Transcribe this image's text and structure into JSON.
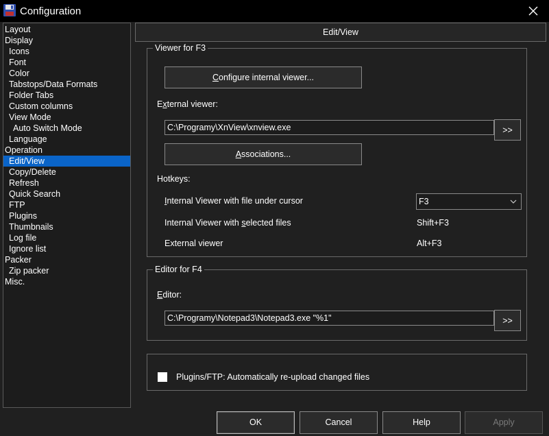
{
  "window": {
    "title": "Configuration"
  },
  "tree": {
    "items": [
      {
        "label": "Layout",
        "indent": 0
      },
      {
        "label": "Display",
        "indent": 0
      },
      {
        "label": "Icons",
        "indent": 1
      },
      {
        "label": "Font",
        "indent": 1
      },
      {
        "label": "Color",
        "indent": 1
      },
      {
        "label": "Tabstops/Data Formats",
        "indent": 1
      },
      {
        "label": "Folder Tabs",
        "indent": 1
      },
      {
        "label": "Custom columns",
        "indent": 1
      },
      {
        "label": "View Mode",
        "indent": 1
      },
      {
        "label": "Auto Switch Mode",
        "indent": 2
      },
      {
        "label": "Language",
        "indent": 1
      },
      {
        "label": "Operation",
        "indent": 0
      },
      {
        "label": "Edit/View",
        "indent": 1,
        "selected": true
      },
      {
        "label": "Copy/Delete",
        "indent": 1
      },
      {
        "label": "Refresh",
        "indent": 1
      },
      {
        "label": "Quick Search",
        "indent": 1
      },
      {
        "label": "FTP",
        "indent": 1
      },
      {
        "label": "Plugins",
        "indent": 1
      },
      {
        "label": "Thumbnails",
        "indent": 1
      },
      {
        "label": "Log file",
        "indent": 1
      },
      {
        "label": "Ignore list",
        "indent": 1
      },
      {
        "label": "Packer",
        "indent": 0
      },
      {
        "label": "Zip packer",
        "indent": 1
      },
      {
        "label": "Misc.",
        "indent": 0
      }
    ]
  },
  "pane": {
    "header": "Edit/View"
  },
  "viewer": {
    "group_title": "Viewer for F3",
    "configure_prefix": "",
    "configure_underlined": "C",
    "configure_rest": "onfigure internal viewer...",
    "external_label_prefix": "E",
    "external_label_underlined": "x",
    "external_label_rest": "ternal viewer:",
    "external_path": "C:\\Programy\\XnView\\xnview.exe",
    "browse_label": ">>",
    "assoc_prefix": "",
    "assoc_underlined": "A",
    "assoc_rest": "ssociations...",
    "hotkeys_label": "Hotkeys:",
    "hk1_prefix": "",
    "hk1_underlined": "I",
    "hk1_rest": "nternal Viewer with file under cursor",
    "hk1_value": "F3",
    "hk2_prefix": "Internal Viewer with ",
    "hk2_underlined": "s",
    "hk2_rest": "elected files",
    "hk2_value": "Shift+F3",
    "hk3_label": "External viewer",
    "hk3_value": "Alt+F3"
  },
  "editor": {
    "group_title": "Editor for F4",
    "label_prefix": "",
    "label_underlined": "E",
    "label_rest": "ditor:",
    "path": "C:\\Programy\\Notepad3\\Notepad3.exe \"%1\"",
    "browse_label": ">>"
  },
  "plugins": {
    "checkbox_label": "Plugins/FTP: Automatically re-upload changed files"
  },
  "buttons": {
    "ok": "OK",
    "cancel": "Cancel",
    "help": "Help",
    "apply": "Apply"
  }
}
